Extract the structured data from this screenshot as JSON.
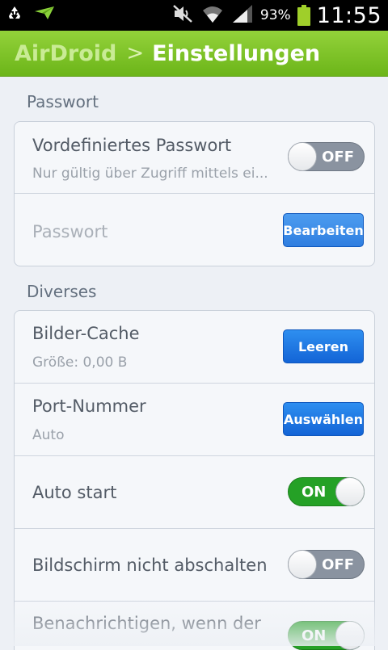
{
  "statusbar": {
    "battery_pct": "93%",
    "time": "11:55",
    "icons": [
      "recycle-icon",
      "airdroid-plane-icon",
      "mute-icon",
      "wifi-icon",
      "signal-icon",
      "battery-icon"
    ]
  },
  "appbar": {
    "app_name": "AirDroid",
    "separator": ">",
    "title": "Einstellungen",
    "accent": "#7cc22a"
  },
  "sections": {
    "passwort": {
      "label": "Passwort",
      "rows": {
        "predefined": {
          "title": "Vordefiniertes Passwort",
          "subtitle": "Nur gültig über Zugriff mittels ei...",
          "toggle": "OFF"
        },
        "password": {
          "title": "Passwort",
          "button": "Bearbeiten"
        }
      }
    },
    "diverses": {
      "label": "Diverses",
      "rows": {
        "cache": {
          "title": "Bilder-Cache",
          "subtitle": "Größe: 0,00 B",
          "button": "Leeren"
        },
        "port": {
          "title": "Port-Nummer",
          "subtitle": "Auto",
          "button": "Auswählen"
        },
        "autostart": {
          "title": "Auto start",
          "toggle": "ON"
        },
        "screen": {
          "title": "Bildschirm nicht abschalten",
          "toggle": "OFF"
        },
        "notify": {
          "title": "Benachrichtigen, wenn der",
          "toggle": "ON"
        }
      }
    }
  }
}
